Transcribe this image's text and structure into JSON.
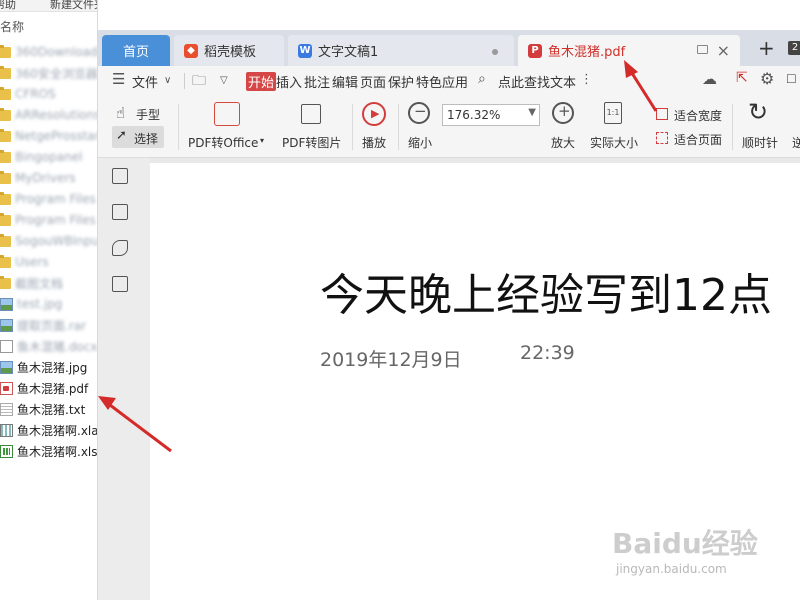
{
  "explorer": {
    "menu_left": "帮助",
    "menu_right": "新建文件夹",
    "column_header": "名称",
    "files": [
      {
        "name": "360Downloads",
        "kind": "folder",
        "blur": true
      },
      {
        "name": "360安全浏览器下载",
        "kind": "folder",
        "blur": true
      },
      {
        "name": "CFROS",
        "kind": "folder",
        "blur": true
      },
      {
        "name": "ARResolutions",
        "kind": "folder",
        "blur": true
      },
      {
        "name": "NetgeProsstartSetting",
        "kind": "folder",
        "blur": true
      },
      {
        "name": "Bingopanel",
        "kind": "folder",
        "blur": true
      },
      {
        "name": "MyDrivers",
        "kind": "folder",
        "blur": true
      },
      {
        "name": "Program Files",
        "kind": "folder",
        "blur": true
      },
      {
        "name": "Program Files (x86)",
        "kind": "folder",
        "blur": true
      },
      {
        "name": "SogouWBInput",
        "kind": "folder",
        "blur": true
      },
      {
        "name": "Users",
        "kind": "folder",
        "blur": true
      },
      {
        "name": "截图文档",
        "kind": "folder",
        "blur": true
      },
      {
        "name": "test.jpg",
        "kind": "img",
        "blur": true
      },
      {
        "name": "提取页面.rar",
        "kind": "img",
        "blur": true
      },
      {
        "name": "鱼木混猪.docx",
        "kind": "doc",
        "blur": true
      },
      {
        "name": "鱼木混猪.jpg",
        "kind": "img",
        "blur": false
      },
      {
        "name": "鱼木混猪.pdf",
        "kind": "pdf",
        "blur": false
      },
      {
        "name": "鱼木混猪.txt",
        "kind": "txt",
        "blur": false
      },
      {
        "name": "鱼木混猪啊.xla",
        "kind": "xla",
        "blur": false
      },
      {
        "name": "鱼木混猪啊.xls",
        "kind": "xls",
        "blur": false
      }
    ]
  },
  "tabs": {
    "home": "首页",
    "template": "稻壳模板",
    "doc": "文字文稿1",
    "pdf": "鱼木混猪.pdf",
    "new_tab": "+",
    "more": "2"
  },
  "menu": {
    "file": "文件",
    "start": "开始",
    "insert": "插入",
    "comment": "批注",
    "edit": "编辑",
    "page": "页面",
    "protect": "保护",
    "special": "特色应用",
    "search": "点此查找文本"
  },
  "ribbon": {
    "hand": "手型",
    "select": "选择",
    "pdf_to_office": "PDF转Office",
    "pdf_to_image": "PDF转图片",
    "play": "播放",
    "zoom_out": "缩小",
    "zoom_value": "176.32%",
    "zoom_in": "放大",
    "actual_size": "实际大小",
    "fit_width": "适合宽度",
    "fit_page": "适合页面",
    "rotate_cw": "顺时针",
    "more": "逆"
  },
  "document": {
    "title": "今天晚上经验写到12点",
    "date": "2019年12月9日",
    "time": "22:39"
  },
  "watermark": {
    "main": "Baidu经验",
    "sub": "jingyan.baidu.com"
  },
  "colors": {
    "accent_blue": "#4a90d9",
    "pdf_red": "#d0302a",
    "arrow_red": "#d42a2a"
  }
}
